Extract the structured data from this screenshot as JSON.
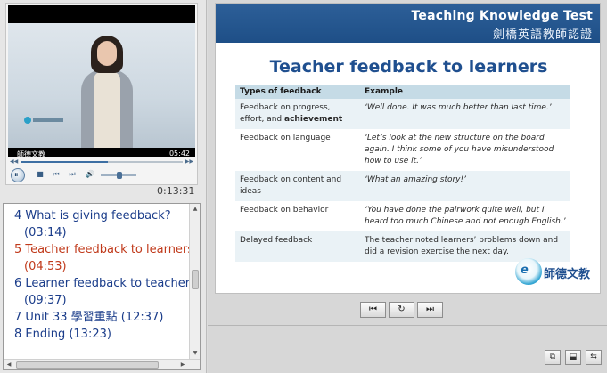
{
  "video": {
    "caption": "師德文教",
    "duration": "05:42",
    "elapsed": "0:13:31",
    "seek_progress": 0.54
  },
  "chapters": [
    {
      "label": "4 What is giving feedback?",
      "time": "(03:14)",
      "active": false
    },
    {
      "label": "5 Teacher feedback to learners",
      "time": "(04:53)",
      "active": true
    },
    {
      "label": "6 Learner feedback to teachers",
      "time": "(09:37)",
      "active": false
    },
    {
      "label": "7 Unit 33 學習重點 (12:37)",
      "time": "",
      "active": false
    },
    {
      "label": "8 Ending (13:23)",
      "time": "",
      "active": false
    }
  ],
  "slide": {
    "header_title": "Teaching Knowledge Test",
    "header_subtitle": "劍橋英語教師認證",
    "title": "Teacher feedback to learners",
    "table": {
      "headers": [
        "Types of feedback",
        "Example"
      ],
      "rows": [
        {
          "type_a": "Feedback on progress, effort, and ",
          "type_b": "achievement",
          "example": "‘Well done. It was much better than last time.’"
        },
        {
          "type_a": "Feedback on language",
          "type_b": "",
          "example": "‘Let’s look at the new structure on the board again. I think some of you have misunderstood how to use it.’"
        },
        {
          "type_a": "Feedback on content and ideas",
          "type_b": "",
          "example": "‘What an amazing story!’"
        },
        {
          "type_a": "Feedback on behavior",
          "type_b": "",
          "example": "‘You have done the pairwork quite well, but I heard too much Chinese and not enough English.’"
        },
        {
          "type_a": "Delayed feedback",
          "type_b": "",
          "example": "The teacher noted learners’ problems down and did a revision exercise the next day."
        }
      ]
    },
    "logo_text": "師德文教"
  },
  "icons": {
    "play_pause": "⏸",
    "stop": "■",
    "prev": "⏮",
    "next": "⏭",
    "volume": "🔊",
    "nav_first": "⏮",
    "nav_replay": "↻",
    "nav_next": "⏭",
    "corner_1": "⧉",
    "corner_2": "⬓",
    "corner_3": "⇆"
  },
  "colors": {
    "header_bg": "#1e4f87",
    "title": "#1f4f8f",
    "chapter_link": "#1a3c8a",
    "chapter_active": "#c0391a",
    "table_header": "#c5dbe6"
  }
}
